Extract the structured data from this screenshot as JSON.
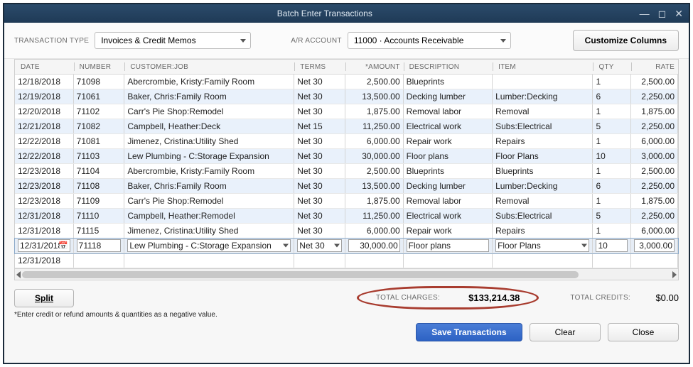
{
  "window": {
    "title": "Batch Enter Transactions"
  },
  "toolbar": {
    "transaction_type_label": "TRANSACTION TYPE",
    "transaction_type_value": "Invoices & Credit Memos",
    "ar_account_label": "A/R ACCOUNT",
    "ar_account_value": "11000 · Accounts Receivable",
    "customize_label": "Customize Columns"
  },
  "columns": {
    "date": "DATE",
    "number": "NUMBER",
    "customer": "CUSTOMER:JOB",
    "terms": "TERMS",
    "amount": "*AMOUNT",
    "description": "DESCRIPTION",
    "item": "ITEM",
    "qty": "QTY",
    "rate": "RATE"
  },
  "rows": [
    {
      "date": "12/18/2018",
      "number": "71098",
      "customer": "Abercrombie, Kristy:Family Room",
      "terms": "Net 30",
      "amount": "2,500.00",
      "description": "Blueprints",
      "item": "",
      "qty": "1",
      "rate": "2,500.00"
    },
    {
      "date": "12/19/2018",
      "number": "71061",
      "customer": "Baker, Chris:Family Room",
      "terms": "Net 30",
      "amount": "13,500.00",
      "description": "Decking lumber",
      "item": "Lumber:Decking",
      "qty": "6",
      "rate": "2,250.00"
    },
    {
      "date": "12/20/2018",
      "number": "71102",
      "customer": "Carr's Pie Shop:Remodel",
      "terms": "Net 30",
      "amount": "1,875.00",
      "description": "Removal labor",
      "item": "Removal",
      "qty": "1",
      "rate": "1,875.00"
    },
    {
      "date": "12/21/2018",
      "number": "71082",
      "customer": "Campbell, Heather:Deck",
      "terms": "Net 15",
      "amount": "11,250.00",
      "description": "Electrical work",
      "item": "Subs:Electrical",
      "qty": "5",
      "rate": "2,250.00"
    },
    {
      "date": "12/22/2018",
      "number": "71081",
      "customer": "Jimenez, Cristina:Utility Shed",
      "terms": "Net 30",
      "amount": "6,000.00",
      "description": "Repair work",
      "item": "Repairs",
      "qty": "1",
      "rate": "6,000.00"
    },
    {
      "date": "12/22/2018",
      "number": "71103",
      "customer": "Lew Plumbing - C:Storage Expansion",
      "terms": "Net 30",
      "amount": "30,000.00",
      "description": "Floor plans",
      "item": "Floor Plans",
      "qty": "10",
      "rate": "3,000.00"
    },
    {
      "date": "12/23/2018",
      "number": "71104",
      "customer": "Abercrombie, Kristy:Family Room",
      "terms": "Net 30",
      "amount": "2,500.00",
      "description": "Blueprints",
      "item": "Blueprints",
      "qty": "1",
      "rate": "2,500.00"
    },
    {
      "date": "12/23/2018",
      "number": "71108",
      "customer": "Baker, Chris:Family Room",
      "terms": "Net 30",
      "amount": "13,500.00",
      "description": "Decking lumber",
      "item": "Lumber:Decking",
      "qty": "6",
      "rate": "2,250.00"
    },
    {
      "date": "12/23/2018",
      "number": "71109",
      "customer": "Carr's Pie Shop:Remodel",
      "terms": "Net 30",
      "amount": "1,875.00",
      "description": "Removal labor",
      "item": "Removal",
      "qty": "1",
      "rate": "1,875.00"
    },
    {
      "date": "12/31/2018",
      "number": "71110",
      "customer": "Campbell, Heather:Remodel",
      "terms": "Net 30",
      "amount": "11,250.00",
      "description": "Electrical work",
      "item": "Subs:Electrical",
      "qty": "5",
      "rate": "2,250.00"
    },
    {
      "date": "12/31/2018",
      "number": "71115",
      "customer": "Jimenez, Cristina:Utility Shed",
      "terms": "Net 30",
      "amount": "6,000.00",
      "description": "Repair work",
      "item": "Repairs",
      "qty": "1",
      "rate": "6,000.00"
    }
  ],
  "active_row": {
    "date": "12/31/2018",
    "number": "71118",
    "customer": "Lew Plumbing - C:Storage Expansion",
    "terms": "Net 30",
    "amount": "30,000.00",
    "description": "Floor plans",
    "item": "Floor Plans",
    "qty": "10",
    "rate": "3,000.00"
  },
  "blank_row": {
    "date": "12/31/2018"
  },
  "split_button": "Split",
  "totals": {
    "charges_label": "TOTAL CHARGES:",
    "charges_value": "$133,214.38",
    "credits_label": "TOTAL CREDITS:",
    "credits_value": "$0.00"
  },
  "footer_note": "*Enter credit or refund amounts & quantities as a negative value.",
  "actions": {
    "save": "Save Transactions",
    "clear": "Clear",
    "close": "Close"
  }
}
